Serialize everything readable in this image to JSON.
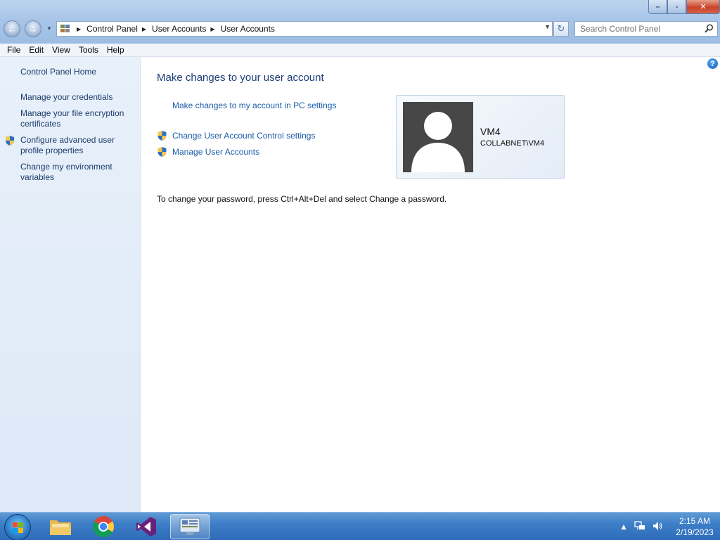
{
  "window": {
    "controls": {
      "minimize": "–",
      "maximize": "▫",
      "close": "✕"
    }
  },
  "navigation": {
    "back": "←",
    "forward": "→",
    "breadcrumbs": [
      "Control Panel",
      "User Accounts",
      "User Accounts"
    ],
    "search_placeholder": "Search Control Panel"
  },
  "menubar": [
    "File",
    "Edit",
    "View",
    "Tools",
    "Help"
  ],
  "sidebar": {
    "items": [
      {
        "label": "Control Panel Home",
        "shield": false
      },
      {
        "label": "Manage your credentials",
        "shield": false
      },
      {
        "label": "Manage your file encryption certificates",
        "shield": false
      },
      {
        "label": "Configure advanced user profile properties",
        "shield": true
      },
      {
        "label": "Change my environment variables",
        "shield": false
      }
    ]
  },
  "main": {
    "title": "Make changes to your user account",
    "links": [
      {
        "label": "Make changes to my account in PC settings",
        "shield": false
      },
      {
        "label": "Change User Account Control settings",
        "shield": true
      },
      {
        "label": "Manage User Accounts",
        "shield": true
      }
    ],
    "hint": "To change your password, press Ctrl+Alt+Del and select Change a password.",
    "help": "?"
  },
  "user": {
    "name": "VM4",
    "domain_account": "COLLABNET\\VM4"
  },
  "taskbar": {
    "apps": [
      "windows-explorer",
      "google-chrome",
      "visual-studio",
      "control-panel"
    ],
    "active_app": "control-panel",
    "time": "2:15 AM",
    "date": "2/19/2023"
  },
  "colors": {
    "link": "#1a5ca8",
    "title": "#1e3c78",
    "sidebar_bg": "#e2ecf8",
    "taskbar": "#3e7fc8"
  }
}
